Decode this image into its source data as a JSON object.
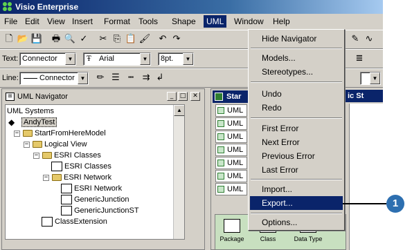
{
  "window": {
    "title": "Visio Enterprise"
  },
  "menubar": [
    {
      "label": "File"
    },
    {
      "label": "Edit"
    },
    {
      "label": "View"
    },
    {
      "label": "Insert"
    },
    {
      "label": "Format"
    },
    {
      "label": "Tools"
    },
    {
      "label": "Shape"
    },
    {
      "label": "UML"
    },
    {
      "label": "Window"
    },
    {
      "label": "Help"
    }
  ],
  "toolbar2": {
    "text_label": "Text:",
    "style_value": "Connector",
    "font_value": "Arial",
    "size_value": "8pt."
  },
  "toolbar3": {
    "line_label": "Line:",
    "line_value": "Connector"
  },
  "navigator": {
    "title": "UML Navigator",
    "tree": [
      {
        "label": "UML Systems"
      },
      {
        "label": "AndyTest"
      },
      {
        "label": "StartFromHereModel",
        "expander": "−"
      },
      {
        "label": "Logical View",
        "expander": "−"
      },
      {
        "label": "ESRI Classes",
        "expander": "−"
      },
      {
        "label": "ESRI Classes"
      },
      {
        "label": "ESRI Network",
        "expander": "−"
      },
      {
        "label": "ESRI Network"
      },
      {
        "label": "GenericJunction"
      },
      {
        "label": "GenericJunctionST"
      },
      {
        "label": "ClassExtension"
      }
    ]
  },
  "stencil": {
    "title_left": "Star",
    "title_right": "ic St",
    "rows": [
      {
        "label": "UML"
      },
      {
        "label": "UML"
      },
      {
        "label": "UML"
      },
      {
        "label": "UML"
      },
      {
        "label": "UML"
      },
      {
        "label": "UML"
      },
      {
        "label": "UML"
      }
    ],
    "shapes": [
      {
        "label": "Package"
      },
      {
        "label": "Class"
      },
      {
        "label": "Data Type"
      }
    ]
  },
  "uml_menu": [
    {
      "label": "Hide Navigator"
    },
    {
      "label": "Models..."
    },
    {
      "label": "Stereotypes..."
    },
    {
      "label": "Undo"
    },
    {
      "label": "Redo"
    },
    {
      "label": "First Error"
    },
    {
      "label": "Next Error"
    },
    {
      "label": "Previous Error"
    },
    {
      "label": "Last Error"
    },
    {
      "label": "Import..."
    },
    {
      "label": "Export...",
      "highlighted": true
    },
    {
      "label": "Options..."
    }
  ],
  "callout": {
    "number": "1"
  },
  "colors": {
    "menu_highlight": "#0a246a",
    "callout": "#2d6fb0",
    "title_bar": "#0a246a"
  }
}
